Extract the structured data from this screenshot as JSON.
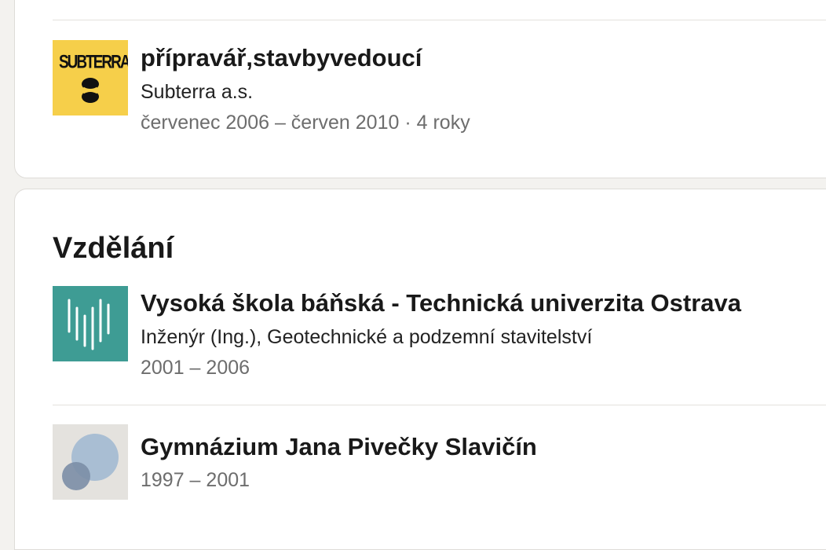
{
  "experience": {
    "items": [
      {
        "title": "přípravář,stavbyvedoucí",
        "company": "Subterra a.s.",
        "dates": "červenec 2006 – červen 2010 · 4 roky",
        "logo_text": "SUBTERRA",
        "logo_icon": "subterra-logo-icon",
        "logo_color": "#f6cf4a"
      }
    ]
  },
  "education": {
    "title": "Vzdělání",
    "items": [
      {
        "school": "Vysoká škola báňská - Technická univerzita Ostrava",
        "degree": "Inženýr (Ing.), Geotechnické a podzemní stavitelství",
        "dates": "2001 – 2006",
        "logo_icon": "vsb-logo-icon",
        "logo_color": "#3e9c94"
      },
      {
        "school": "Gymnázium Jana Pivečky Slavičín",
        "dates": "1997 – 2001",
        "logo_icon": "school-placeholder-icon",
        "logo_color": "#e4e2de"
      }
    ]
  }
}
